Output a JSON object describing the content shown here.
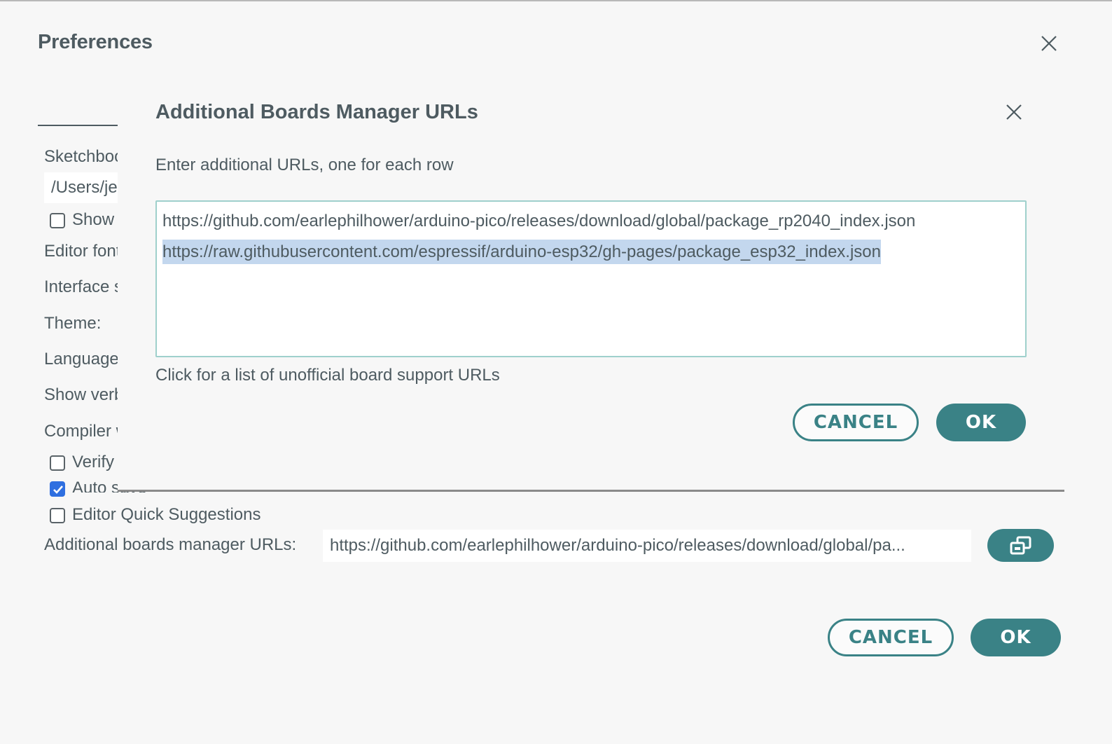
{
  "preferences": {
    "title": "Preferences",
    "close_icon": "close-icon",
    "sidebar": {
      "sketchbook_label": "Sketchbook location:",
      "sketchbook_path": "/Users/je",
      "show_files_label": "Show files inside Sketches",
      "editor_font_label": "Editor font size:",
      "interface_scale_label": "Interface scale:",
      "theme_label": "Theme:",
      "language_label": "Language:",
      "show_verbose_label": "Show verbose output during",
      "compiler_warnings_label": "Compiler warnings"
    },
    "checkboxes": [
      {
        "label": "Verify code after upload",
        "checked": false
      },
      {
        "label": "Auto save",
        "checked": true
      },
      {
        "label": "Editor Quick Suggestions",
        "checked": false
      }
    ],
    "additional_urls": {
      "label": "Additional boards manager URLs:",
      "value": "https://github.com/earlephilhower/arduino-pico/releases/download/global/package_rp2040_index.json,https://raw.githubusercontent.com/espressif/arduino-esp32/gh-pages/package_esp32_index.json",
      "display_value": "https://github.com/earlephilhower/arduino-pico/releases/download/global/pa...",
      "edit_button_icon": "open-window-icon"
    },
    "buttons": {
      "cancel": "CANCEL",
      "ok": "OK"
    }
  },
  "dialog": {
    "title": "Additional Boards Manager URLs",
    "close_icon": "close-icon",
    "instructions": "Enter additional URLs, one for each row",
    "urls": [
      "https://github.com/earlephilhower/arduino-pico/releases/download/global/package_rp2040_index.json",
      "https://raw.githubusercontent.com/espressif/arduino-esp32/gh-pages/package_esp32_index.json"
    ],
    "selected_row": 1,
    "link": "Click for a list of unofficial board support URLs",
    "buttons": {
      "cancel": "CANCEL",
      "ok": "OK"
    }
  },
  "colors": {
    "accent": "#3a8286",
    "background": "#f7f7f7",
    "text": "#4e5b61",
    "selection": "#c3d7ee",
    "checkbox_checked": "#2f6fe0"
  }
}
